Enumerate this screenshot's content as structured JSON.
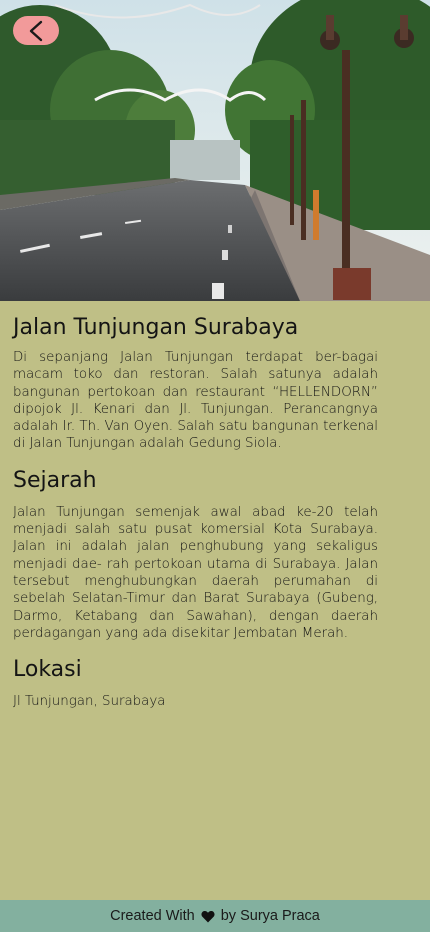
{
  "header": {
    "back_icon": "chevron-left-icon",
    "accent_color": "#f29a9a"
  },
  "article": {
    "title": "Jalan Tunjungan Surabaya",
    "intro": "Di sepanjang Jalan Tunjungan terdapat ber-bagai macam toko dan restoran. Salah satunya adalah bangunan pertokoan dan restaurant “HELLENDORN” dipojok Jl. Kenari dan Jl. Tunjungan. Perancangnya adalah Ir. Th. Van Oyen. Salah satu bangunan terkenal di Jalan Tunjungan adalah Gedung Siola.",
    "sections": [
      {
        "heading": "Sejarah",
        "body": "Jalan Tunjungan semenjak awal abad ke-20 telah menjadi salah satu pusat komersial Kota Surabaya. Jalan ini adalah jalan penghubung yang sekaligus menjadi dae- rah pertokoan utama di Surabaya. Jalan tersebut menghubungkan daerah perumahan di sebelah Selatan-Timur dan Barat Surabaya (Gubeng, Darmo, Ketabang dan Sawahan), dengan daerah perdagangan yang ada disekitar Jembatan Merah."
      },
      {
        "heading": "Lokasi",
        "body": "Jl Tunjungan, Surabaya"
      }
    ]
  },
  "footer": {
    "prefix": "Created With",
    "icon": "heart-icon",
    "suffix": "by Surya Praca",
    "background": "#83b09f"
  },
  "colors": {
    "page_background": "#bfbf86"
  }
}
